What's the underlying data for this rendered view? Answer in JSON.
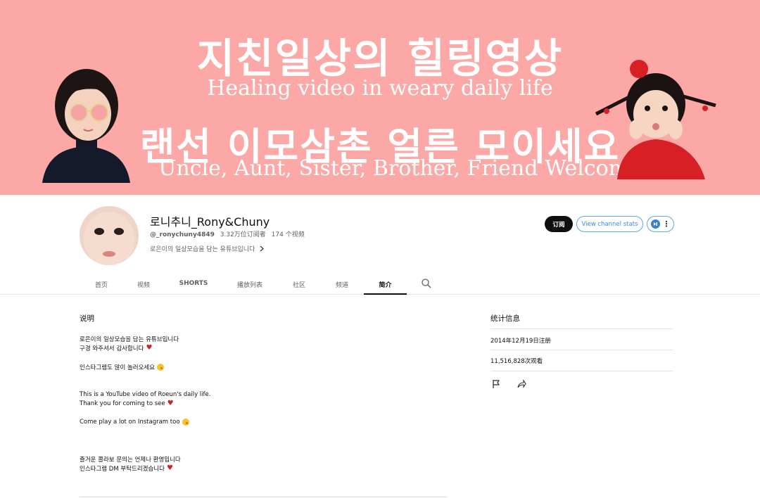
{
  "banner": {
    "line1": "지친일상의 힐링영상",
    "line2": "Healing video in weary daily life",
    "line3": "랜선 이모삼촌 얼른 모이세요",
    "line4": "Uncle, Aunt, Sister, Brother, Friend Welcome",
    "background_color": "#fba8a6"
  },
  "channel": {
    "name": "로니추니_Rony&Chuny",
    "handle": "@_ronychuny4849",
    "subscribers": "3.32万位订阅者",
    "videos": "174 个视频",
    "tagline": "로은이의 일상모습을 담는 유튜브입니다"
  },
  "actions": {
    "subscribe_label": "订阅",
    "stats_label": "View channel stats",
    "more_icon": "more-vert-icon"
  },
  "tabs": [
    {
      "label": "首页",
      "active": false
    },
    {
      "label": "视频",
      "active": false
    },
    {
      "label": "SHORTS",
      "active": false
    },
    {
      "label": "播放列表",
      "active": false
    },
    {
      "label": "社区",
      "active": false
    },
    {
      "label": "频道",
      "active": false
    },
    {
      "label": "简介",
      "active": true
    }
  ],
  "about": {
    "title": "说明",
    "lines": [
      "로은이의 일상모습을 담는 유튜브입니다",
      "구경 와주셔서 감사합니다",
      "인스타그램도 많이 놀러오세요",
      "This is a YouTube video of Roeun's daily life.",
      "Thank you for coming to see",
      "Come play a lot on Instagram too",
      "즐거운 콜라보 문의는 언제나 환영입니다",
      "인스타그램 DM 부탁드리겠습니다"
    ]
  },
  "stats": {
    "title": "统计信息",
    "joined": "2014年12月19日注册",
    "views": "11,516,828次观看"
  },
  "colors": {
    "accent_blue": "#3b8de0",
    "heart_red": "#c62828"
  }
}
